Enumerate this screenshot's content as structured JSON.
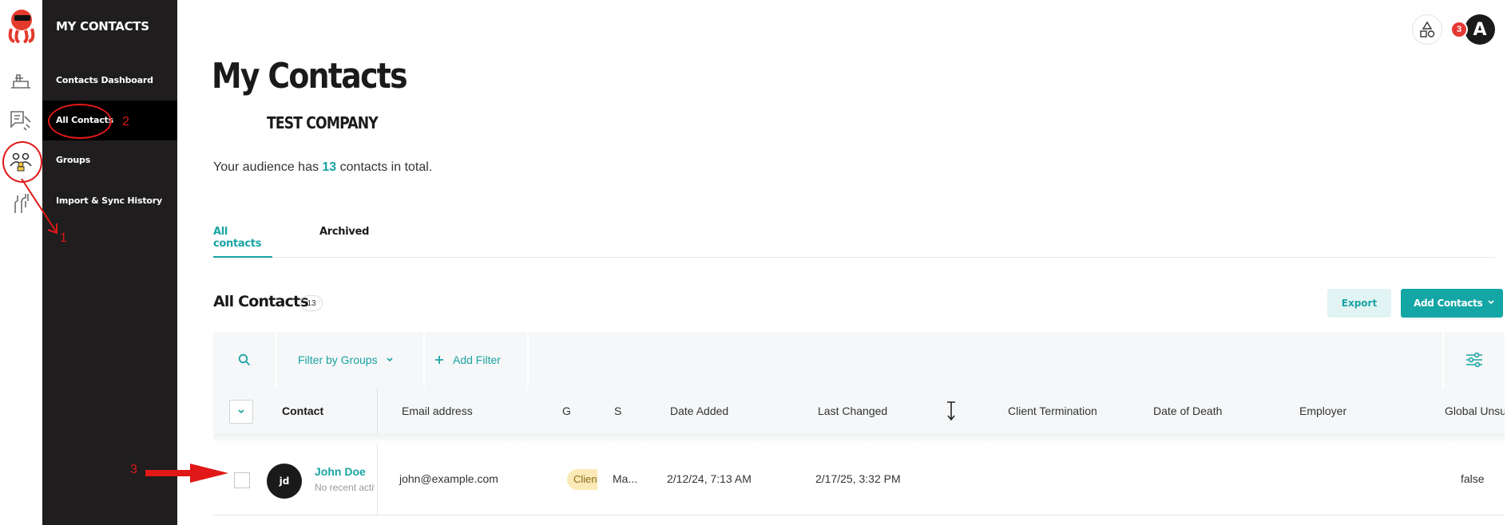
{
  "sidebar": {
    "brand": "MY CONTACTS",
    "items": [
      {
        "label": "Contacts Dashboard"
      },
      {
        "label": "All Contacts"
      },
      {
        "label": "Groups"
      },
      {
        "label": "Import & Sync History"
      }
    ]
  },
  "header": {
    "notification_count": "3",
    "avatar_letter": "A"
  },
  "page": {
    "title": "My Contacts",
    "company": "TEST COMPANY",
    "audience_prefix": "Your audience has ",
    "audience_count": "13",
    "audience_suffix": " contacts in total."
  },
  "tabs": [
    {
      "label": "All contacts",
      "active": true
    },
    {
      "label": "Archived",
      "active": false
    }
  ],
  "section": {
    "title": "All Contacts",
    "count": "13",
    "export_label": "Export",
    "add_label": "Add Contacts"
  },
  "filters": {
    "groups_label": "Filter by Groups",
    "add_filter_label": "Add Filter"
  },
  "table": {
    "columns": [
      "Contact",
      "Email address",
      "G",
      "S",
      "Date Added",
      "Last Changed",
      "Client Termination",
      "Date of Death",
      "Employer",
      "Global Unsubsc"
    ],
    "rows": [
      {
        "initials": "jd",
        "name": "John Doe",
        "subtitle": "No recent activity",
        "email": "john@example.com",
        "group_tag": "Client",
        "status": "Ma...",
        "date_added": "2/12/24, 7:13 AM",
        "last_changed": "2/17/25, 3:32 PM",
        "global_unsubscribe": "false"
      }
    ]
  },
  "annotations": [
    "1",
    "2",
    "3"
  ],
  "colors": {
    "accent": "#1aa3a3",
    "sidebar_bg": "#1f1d1d",
    "highlight": "#f5c842",
    "annotation": "#e01818"
  }
}
